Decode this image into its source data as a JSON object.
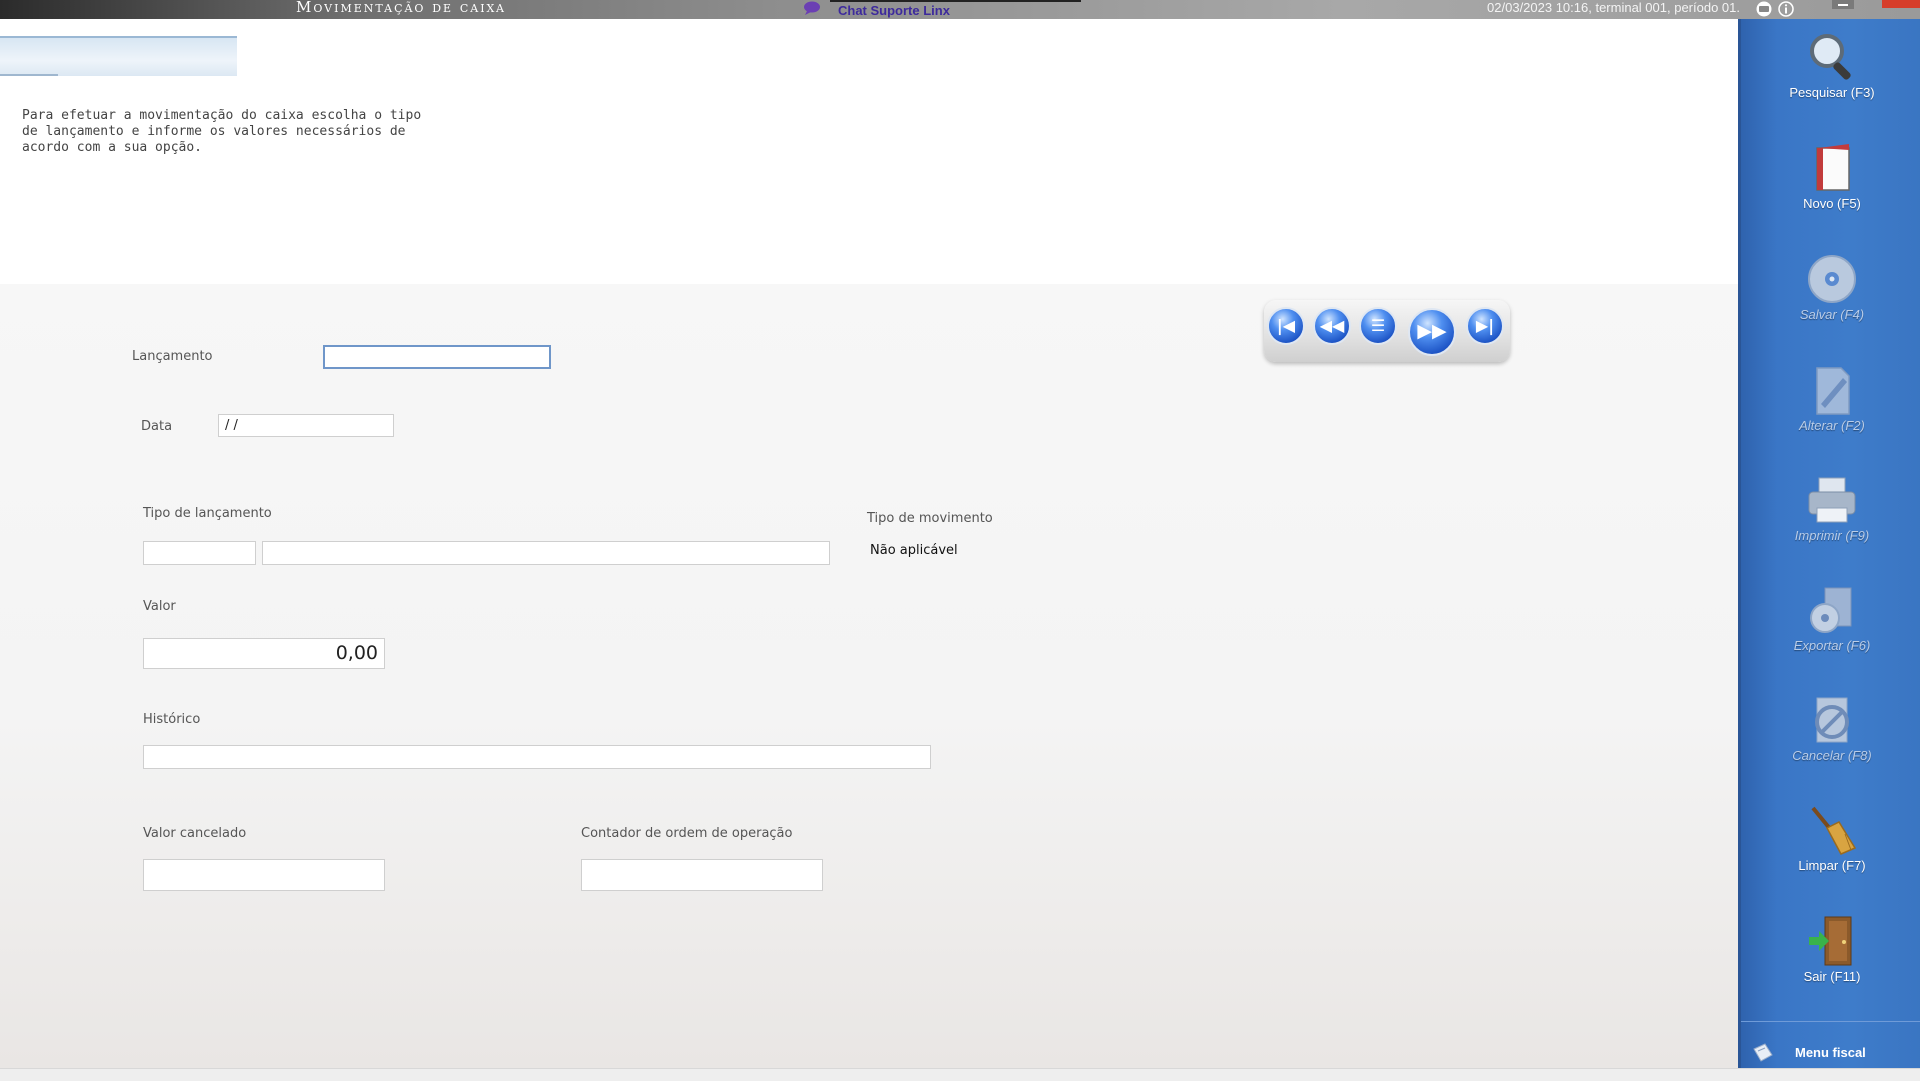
{
  "titlebar": {
    "app_title": "Movimentação de caixa",
    "chat_link": "Chat Suporte Linx",
    "status": "02/03/2023 10:16, terminal 001, período 01."
  },
  "intro": {
    "text": "Para efetuar a movimentação do caixa escolha o tipo de lançamento e informe os valores necessários de acordo com a sua opção."
  },
  "form": {
    "lancamento_label": "Lançamento",
    "lancamento_value": "",
    "data_label": "Data",
    "data_value": " /  /",
    "tipo_lancamento_label": "Tipo de lançamento",
    "tipo_lancamento_code": "",
    "tipo_lancamento_desc": "",
    "tipo_movimento_label": "Tipo de movimento",
    "tipo_movimento_value": "Não aplicável",
    "valor_label": "Valor",
    "valor_value": "0,00",
    "historico_label": "Histórico",
    "historico_value": "",
    "valor_cancelado_label": "Valor cancelado",
    "valor_cancelado_value": "",
    "contador_label": "Contador de ordem de operação",
    "contador_value": ""
  },
  "nav": {
    "first_icon": "first-record-icon",
    "prev_icon": "previous-record-icon",
    "list_icon": "list-records-icon",
    "next_icon": "next-record-icon",
    "last_icon": "last-record-icon"
  },
  "sidebar": {
    "items": [
      {
        "label": "Pesquisar (F3)",
        "icon": "magnifier-icon",
        "enabled": true
      },
      {
        "label": "Novo (F5)",
        "icon": "new-document-icon",
        "enabled": true
      },
      {
        "label": "Salvar (F4)",
        "icon": "disk-icon",
        "enabled": false
      },
      {
        "label": "Alterar (F2)",
        "icon": "edit-pen-icon",
        "enabled": false
      },
      {
        "label": "Imprimir (F9)",
        "icon": "printer-icon",
        "enabled": false
      },
      {
        "label": "Exportar (F6)",
        "icon": "export-icon",
        "enabled": false
      },
      {
        "label": "Cancelar (F8)",
        "icon": "cancel-icon",
        "enabled": false
      },
      {
        "label": "Limpar (F7)",
        "icon": "broom-icon",
        "enabled": true
      },
      {
        "label": "Sair (F11)",
        "icon": "exit-door-icon",
        "enabled": true
      }
    ],
    "menu_fiscal": "Menu fiscal"
  },
  "colors": {
    "sidebar_blue": "#3e7cca",
    "focus_border": "#6f96c9",
    "chat_link": "#3d2a9c",
    "close_red": "#d63d2a"
  }
}
